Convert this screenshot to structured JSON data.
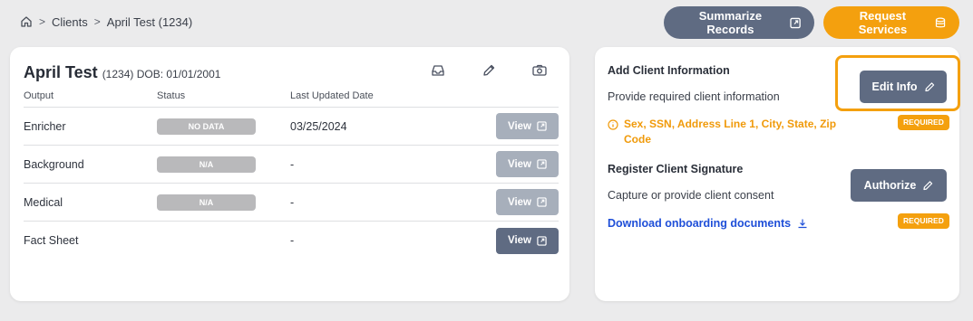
{
  "breadcrumb": {
    "items": [
      "Clients",
      "April Test (1234)"
    ]
  },
  "top_actions": {
    "summarize_label": "Summarize Records",
    "request_label": "Request Services"
  },
  "client": {
    "name": "April Test",
    "meta": "(1234) DOB: 01/01/2001"
  },
  "table": {
    "headers": [
      "Output",
      "Status",
      "Last Updated Date"
    ],
    "rows": [
      {
        "output": "Enricher",
        "status": "NO DATA",
        "date": "03/25/2024",
        "view": "View",
        "enabled": false
      },
      {
        "output": "Background",
        "status": "N/A",
        "date": "-",
        "view": "View",
        "enabled": false
      },
      {
        "output": "Medical",
        "status": "N/A",
        "date": "-",
        "view": "View",
        "enabled": false
      },
      {
        "output": "Fact Sheet",
        "status": "",
        "date": "-",
        "view": "View",
        "enabled": true
      }
    ]
  },
  "add_info": {
    "title": "Add Client Information",
    "text": "Provide required client information",
    "button": "Edit Info",
    "required": "REQUIRED",
    "missing": "Sex, SSN, Address Line 1, City, State, Zip Code"
  },
  "signature": {
    "title": "Register Client Signature",
    "text": "Capture or provide client consent",
    "button": "Authorize",
    "required": "REQUIRED",
    "download": "Download onboarding documents"
  },
  "colors": {
    "accent": "#f4a00e",
    "slate": "#5f6b82",
    "link": "#1f4fd8"
  }
}
